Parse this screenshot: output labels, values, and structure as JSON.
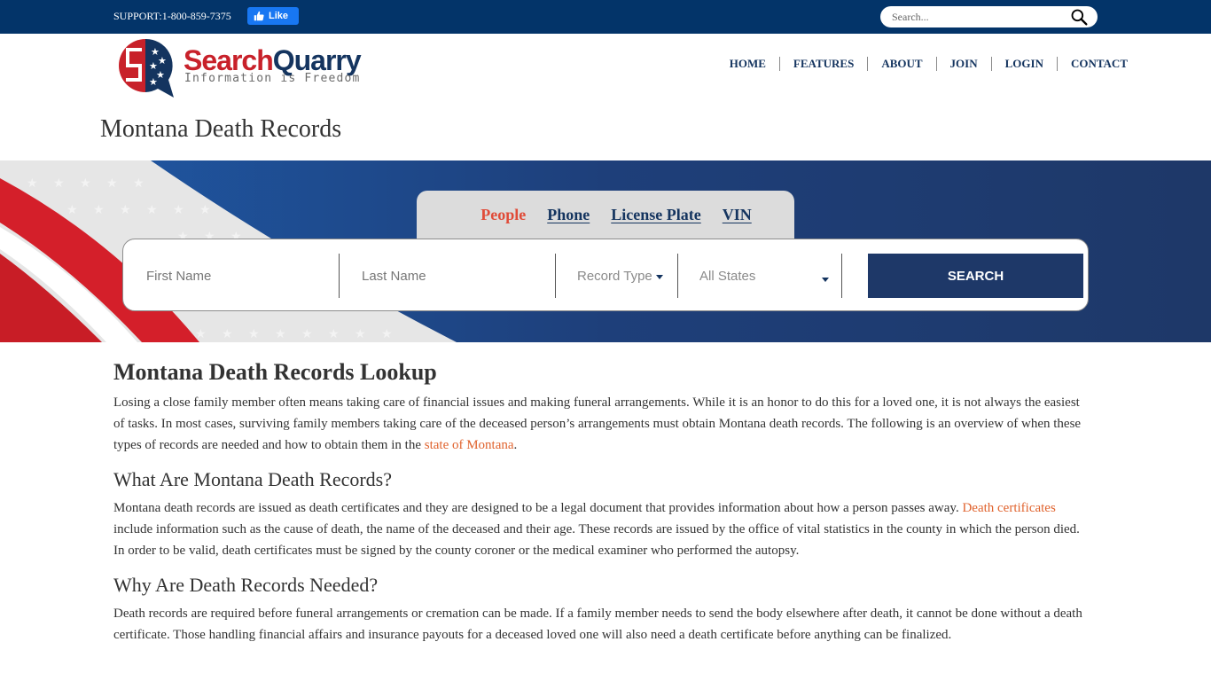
{
  "topbar": {
    "support_text": "SUPPORT:1-800-859-7375",
    "fb_like_label": "Like",
    "search_placeholder": "Search..."
  },
  "header": {
    "logo_word1": "Search",
    "logo_word2": "Quarry",
    "logo_tagline": "Information is Freedom",
    "nav": [
      "HOME",
      "FEATURES",
      "ABOUT",
      "JOIN",
      "LOGIN",
      "CONTACT"
    ]
  },
  "page_title": "Montana Death Records",
  "search": {
    "tabs": [
      {
        "label": "People",
        "active": true
      },
      {
        "label": "Phone",
        "active": false
      },
      {
        "label": "License Plate",
        "active": false
      },
      {
        "label": "VIN",
        "active": false
      }
    ],
    "first_name_placeholder": "First Name",
    "last_name_placeholder": "Last Name",
    "record_type_label": "Record Type",
    "state_label": "All States",
    "submit_label": "SEARCH"
  },
  "article": {
    "h1": "Montana Death Records Lookup",
    "p1_before": "Losing a close family member often means taking care of financial issues and making funeral arrangements. While it is an honor to do this for a loved one, it is not always the easiest of tasks. In most cases, surviving family members taking care of the deceased person’s arrangements must obtain Montana death records. The following is an overview of when these types of records are needed and how to obtain them in the ",
    "p1_link": "state of Montana",
    "p1_after": ".",
    "h2_1": "What Are Montana Death Records?",
    "p2_before": "Montana death records are issued as death certificates and they are designed to be a legal document that provides information about how a person passes away. ",
    "p2_link": "Death certificates",
    "p2_after": " include information such as the cause of death, the name of the deceased and their age. These records are issued by the office of vital statistics in the county in which the person died. In order to be valid, death certificates must be signed by the county coroner or the medical examiner who performed the autopsy.",
    "h2_2": "Why Are Death Records Needed?",
    "p3": "Death records are required before funeral arrangements or cremation can be made. If a family member needs to send the body elsewhere after death, it cannot be done without a death certificate. Those handling financial affairs and insurance payouts for a deceased loved one will also need a death certificate before anything can be finalized."
  },
  "colors": {
    "topbar": "#033469",
    "brand_navy": "#14345f",
    "brand_red": "#c8212a",
    "banner_navy": "#1e3868",
    "active_tab": "#e04b38",
    "link": "#e0632e"
  }
}
